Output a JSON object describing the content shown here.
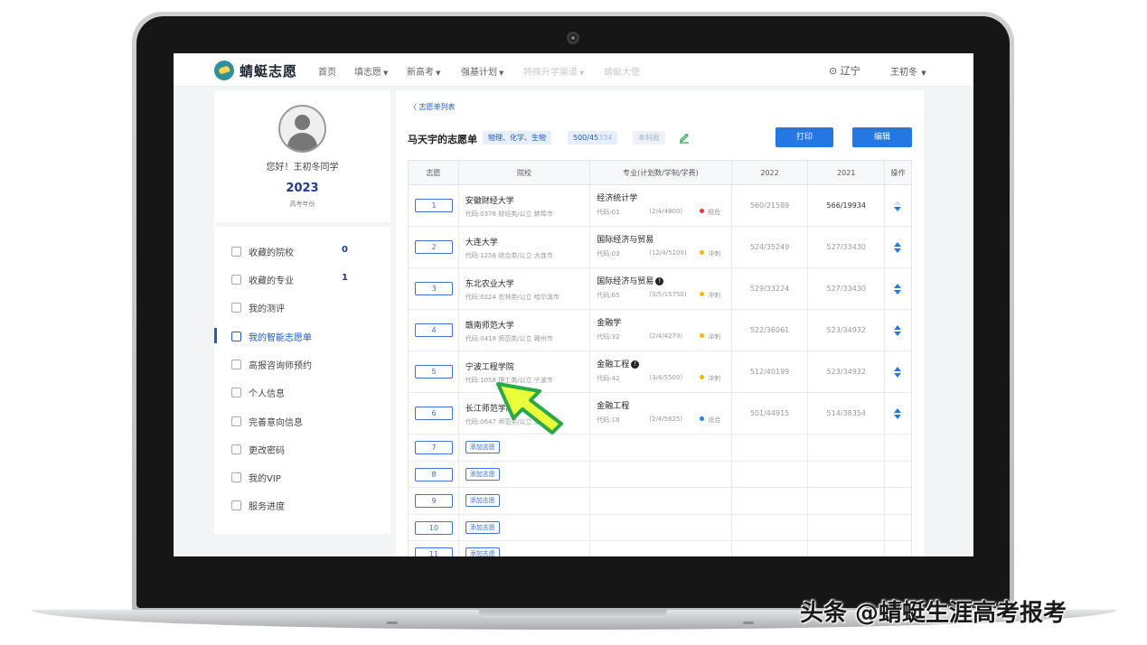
{
  "nav": {
    "logo": "蜻蜓志愿",
    "items": [
      {
        "label": "首页",
        "dropdown": false
      },
      {
        "label": "填志愿",
        "dropdown": true
      },
      {
        "label": "新高考",
        "dropdown": true
      },
      {
        "label": "强基计划",
        "dropdown": true
      },
      {
        "label": "特殊升学渠道",
        "dropdown": true
      },
      {
        "label": "蜻蜓大使",
        "dropdown": false
      }
    ],
    "location": "辽宁",
    "user": "王初冬"
  },
  "profile": {
    "greeting": "您好！王初冬同学",
    "year": "2023",
    "year_label": "高考年份"
  },
  "sidebar": {
    "items": [
      {
        "label": "收藏的院校",
        "count": "0"
      },
      {
        "label": "收藏的专业",
        "count": "1"
      },
      {
        "label": "我的测评",
        "count": ""
      },
      {
        "label": "我的智能志愿单",
        "count": "",
        "active": true
      },
      {
        "label": "高报咨询师预约",
        "count": ""
      },
      {
        "label": "个人信息",
        "count": ""
      },
      {
        "label": "完善意向信息",
        "count": ""
      },
      {
        "label": "更改密码",
        "count": ""
      },
      {
        "label": "我的VIP",
        "count": ""
      },
      {
        "label": "服务进度",
        "count": ""
      }
    ]
  },
  "main": {
    "back_link": "志愿单列表",
    "title": "马天宇的志愿单",
    "subjects_tag": "物理、化学、生物",
    "score_main": "500/45",
    "score_dim": "334",
    "batch_tag": "本科批",
    "print_button": "打印",
    "edit_button": "编辑",
    "table": {
      "headers": [
        "志愿",
        "院校",
        "专业(计划数/学制/学费)",
        "2022",
        "2021",
        "操作"
      ],
      "rows": [
        {
          "rank": "1",
          "school": "安徽财经大学",
          "school_info": "代码:0378  财经类/公立  蚌埠市",
          "major": "经济统计学",
          "info": false,
          "code": "代码:01",
          "plan": "(2/4/4900)",
          "risk": "极危",
          "risk_color": "#e53935",
          "y2022": "560/21589",
          "y2021": "566/19934",
          "y2021_dark": true,
          "first": true
        },
        {
          "rank": "2",
          "school": "大连大学",
          "school_info": "代码:1258  综合类/公立  大连市",
          "major": "国际经济与贸易",
          "info": false,
          "code": "代码:03",
          "plan": "(12/4/5200)",
          "risk": "冲刺",
          "risk_color": "#f5b800",
          "y2022": "524/35249",
          "y2021": "527/33430",
          "y2021_dark": false,
          "first": false
        },
        {
          "rank": "3",
          "school": "东北农业大学",
          "school_info": "代码:0224  农林类/公立  哈尔滨市",
          "major": "国际经济与贸易",
          "info": true,
          "code": "代码:65",
          "plan": "(3/5/15750)",
          "risk": "冲刺",
          "risk_color": "#f5b800",
          "y2022": "529/33224",
          "y2021": "527/33430",
          "y2021_dark": false,
          "first": false
        },
        {
          "rank": "4",
          "school": "赣南师范大学",
          "school_info": "代码:0418  师范类/公立  赣州市",
          "major": "金融学",
          "info": false,
          "code": "代码:32",
          "plan": "(2/4/4270)",
          "risk": "冲刺",
          "risk_color": "#f5b800",
          "y2022": "522/36061",
          "y2021": "523/34932",
          "y2021_dark": false,
          "first": false
        },
        {
          "rank": "5",
          "school": "宁波工程学院",
          "school_info": "代码:1058  理工类/公立  宁波市",
          "major": "金融工程",
          "info": true,
          "code": "代码:42",
          "plan": "(3/4/5500)",
          "risk": "冲刺",
          "risk_color": "#f5b800",
          "y2022": "512/40199",
          "y2021": "523/34932",
          "y2021_dark": false,
          "first": false
        },
        {
          "rank": "6",
          "school": "长江师范学院",
          "school_info": "代码:0647  师范类/公立  重庆市",
          "major": "金融工程",
          "info": false,
          "code": "代码:18",
          "plan": "(2/4/5625)",
          "risk": "适合",
          "risk_color": "#1e88e5",
          "y2022": "501/44915",
          "y2021": "514/38354",
          "y2021_dark": false,
          "first": false
        }
      ],
      "empty_rows": [
        {
          "rank": "7",
          "add_label": "添加志愿"
        },
        {
          "rank": "8",
          "add_label": "添加志愿"
        },
        {
          "rank": "9",
          "add_label": "添加志愿"
        },
        {
          "rank": "10",
          "add_label": "添加志愿"
        },
        {
          "rank": "11",
          "add_label": "添加志愿"
        }
      ]
    }
  },
  "cursor_icon": "arrow-pointer-icon",
  "watermark": "头条 @蜻蜓生涯高考报考",
  "colors": {
    "accent": "#2577e3",
    "brand_dark": "#1d3e8c",
    "pointer_fill": "#e8ff3a",
    "pointer_stroke": "#2aa84a"
  }
}
